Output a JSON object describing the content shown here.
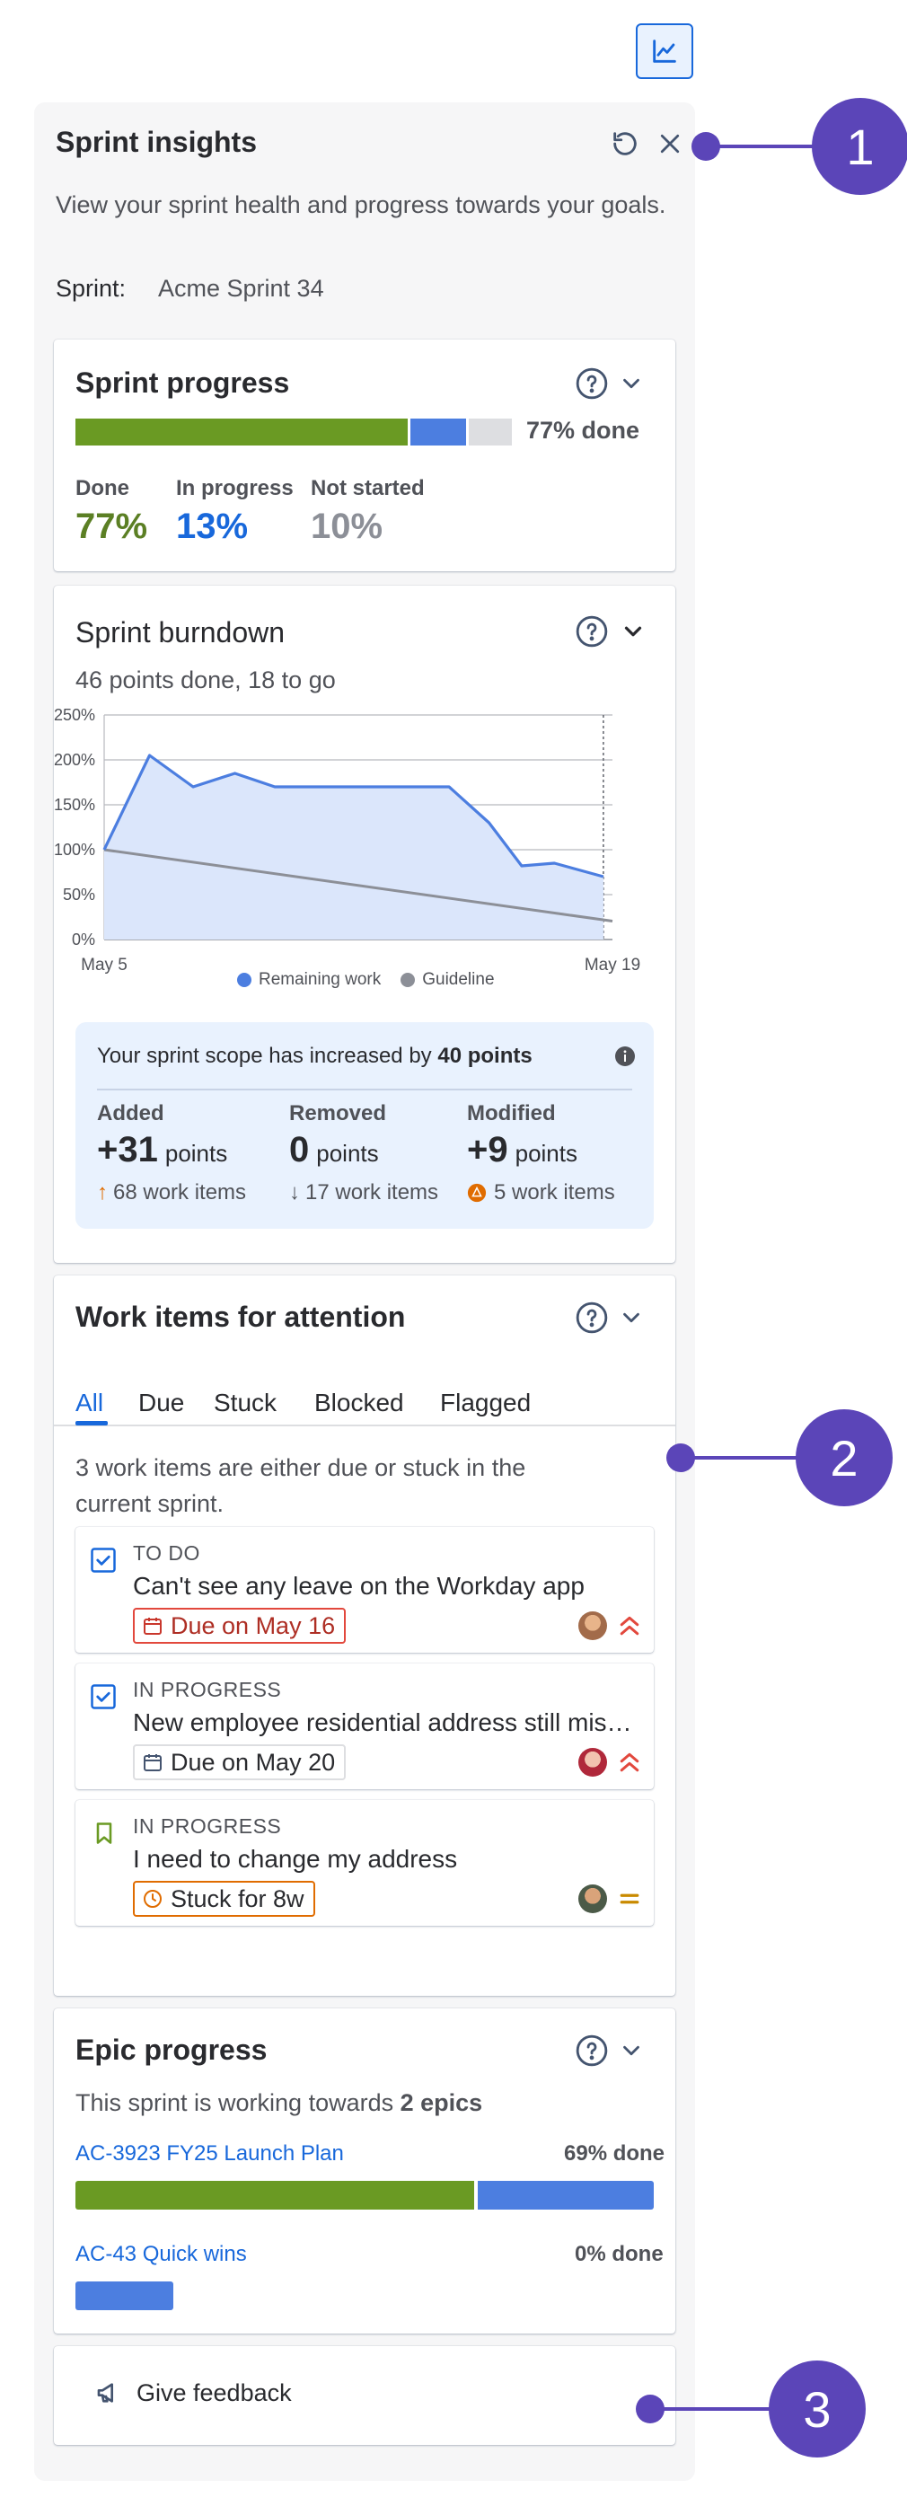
{
  "panel": {
    "title": "Sprint insights",
    "description": "View your sprint health and progress towards your goals.",
    "sprint_label": "Sprint:",
    "sprint_name": "Acme Sprint 34"
  },
  "sprint_progress": {
    "title": "Sprint progress",
    "done_summary": "77% done",
    "segments": {
      "done_fraction": 0.77,
      "in_progress_fraction": 0.13,
      "not_started_fraction": 0.1
    },
    "stats": [
      {
        "label": "Done",
        "value": "77%",
        "color": "#5b7f24"
      },
      {
        "label": "In progress",
        "value": "13%",
        "color": "#1868db"
      },
      {
        "label": "Not started",
        "value": "10%",
        "color": "#8c8f97"
      }
    ]
  },
  "burndown": {
    "title": "Sprint burndown",
    "subtitle": "46 points done, 18 to go",
    "legend_remaining": "Remaining work",
    "legend_guideline": "Guideline",
    "scope": {
      "text_prefix": "Your sprint scope has increased by ",
      "text_bold": "40 points",
      "columns": [
        {
          "label": "Added",
          "number": "+31",
          "unit": "points",
          "sub": "68 work items",
          "sub_icon": "arrow-up-icon"
        },
        {
          "label": "Removed",
          "number": "0",
          "unit": "points",
          "sub": "17 work items",
          "sub_icon": "arrow-down-icon"
        },
        {
          "label": "Modified",
          "number": "+9",
          "unit": "points",
          "sub": "5 work items",
          "sub_icon": "warning-icon"
        }
      ]
    }
  },
  "chart_data": {
    "type": "line",
    "title": "",
    "xlabel": "",
    "ylabel": "",
    "x_tick_labels": [
      "May 5",
      "May 19"
    ],
    "y_tick_labels": [
      "0%",
      "50%",
      "100%",
      "150%",
      "200%",
      "250%"
    ],
    "ylim": [
      0,
      250
    ],
    "x_days": 14,
    "grid": true,
    "legend_placement": "bottom",
    "series": [
      {
        "name": "Remaining work",
        "color": "#4c7ee0",
        "fill": "#dbe6fb",
        "points": [
          [
            0,
            100
          ],
          [
            1.25,
            205
          ],
          [
            2.45,
            170
          ],
          [
            3.6,
            185
          ],
          [
            4.7,
            170
          ],
          [
            6.0,
            170
          ],
          [
            7.35,
            170
          ],
          [
            9.5,
            170
          ],
          [
            10.6,
            130
          ],
          [
            11.5,
            82
          ],
          [
            12.4,
            85
          ],
          [
            13.75,
            70
          ]
        ]
      },
      {
        "name": "Guideline",
        "color": "#8c8f97",
        "points": [
          [
            0,
            100
          ],
          [
            17.6,
            0
          ]
        ]
      }
    ],
    "vertical_markers": [
      13.75,
      17.6
    ]
  },
  "attention": {
    "title": "Work items for attention",
    "tabs": [
      "All",
      "Due",
      "Stuck",
      "Blocked",
      "Flagged"
    ],
    "summary": "3 work items are either due or stuck in the current sprint.",
    "items": [
      {
        "status": "TO DO",
        "title": "Can't see any leave on the Workday app",
        "lozenge": "Due on May 16"
      },
      {
        "status": "IN PROGRESS",
        "title": "New employee residential address still missing",
        "lozenge": "Due on May 20"
      },
      {
        "status": "IN PROGRESS",
        "title": "I need to change my address",
        "lozenge": "Stuck for 8w"
      }
    ]
  },
  "epics": {
    "title": "Epic progress",
    "summary_prefix": "This sprint is working towards ",
    "summary_bold": "2 epics",
    "list": [
      {
        "key": "AC-3923 FY25 Launch Plan",
        "pct": "69% done",
        "done_fraction": 0.69,
        "inprogress_fraction": 0.31
      },
      {
        "key": "AC-43 Quick wins",
        "pct": "0% done",
        "done_fraction": 0.0,
        "inprogress_fraction": 0.17
      }
    ]
  },
  "feedback": {
    "label": "Give feedback"
  },
  "callouts": [
    "1",
    "2",
    "3"
  ],
  "colors": {
    "done_green": "#6a9a23",
    "in_progress_blue": "#4c7ee0",
    "not_started_gray": "#dddee1",
    "callout_purple": "#5b45b8",
    "danger_red": "#c9372c",
    "warning_orange": "#e06c00"
  }
}
